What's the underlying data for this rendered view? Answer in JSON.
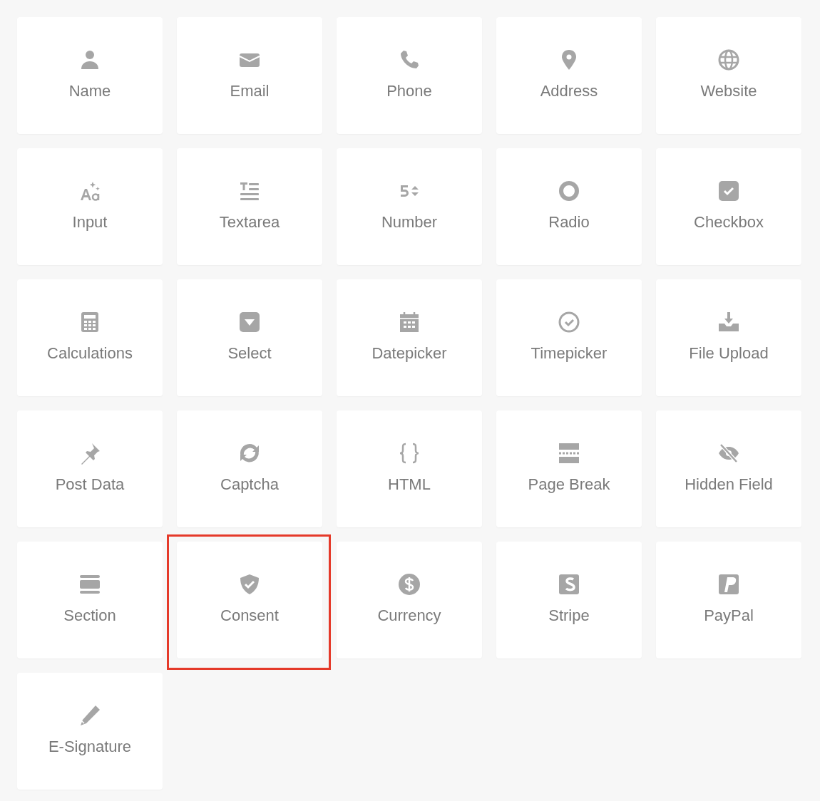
{
  "items": [
    {
      "label": "Name",
      "highlighted": false
    },
    {
      "label": "Email",
      "highlighted": false
    },
    {
      "label": "Phone",
      "highlighted": false
    },
    {
      "label": "Address",
      "highlighted": false
    },
    {
      "label": "Website",
      "highlighted": false
    },
    {
      "label": "Input",
      "highlighted": false
    },
    {
      "label": "Textarea",
      "highlighted": false
    },
    {
      "label": "Number",
      "highlighted": false
    },
    {
      "label": "Radio",
      "highlighted": false
    },
    {
      "label": "Checkbox",
      "highlighted": false
    },
    {
      "label": "Calculations",
      "highlighted": false
    },
    {
      "label": "Select",
      "highlighted": false
    },
    {
      "label": "Datepicker",
      "highlighted": false
    },
    {
      "label": "Timepicker",
      "highlighted": false
    },
    {
      "label": "File Upload",
      "highlighted": false
    },
    {
      "label": "Post Data",
      "highlighted": false
    },
    {
      "label": "Captcha",
      "highlighted": false
    },
    {
      "label": "HTML",
      "highlighted": false
    },
    {
      "label": "Page Break",
      "highlighted": false
    },
    {
      "label": "Hidden Field",
      "highlighted": false
    },
    {
      "label": "Section",
      "highlighted": false
    },
    {
      "label": "Consent",
      "highlighted": true
    },
    {
      "label": "Currency",
      "highlighted": false
    },
    {
      "label": "Stripe",
      "highlighted": false
    },
    {
      "label": "PayPal",
      "highlighted": false
    },
    {
      "label": "E-Signature",
      "highlighted": false
    }
  ]
}
